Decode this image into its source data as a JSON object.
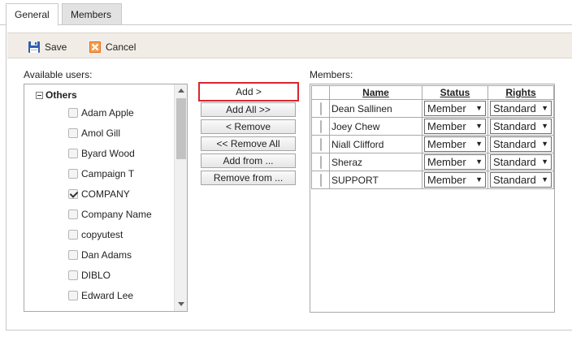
{
  "tabs": [
    {
      "label": "General",
      "active": true
    },
    {
      "label": "Members",
      "active": false
    }
  ],
  "toolbar": {
    "save_label": "Save",
    "cancel_label": "Cancel"
  },
  "available": {
    "label": "Available users:",
    "group": "Others",
    "users": [
      {
        "name": "Adam Apple",
        "checked": false
      },
      {
        "name": "Amol Gill",
        "checked": false
      },
      {
        "name": "Byard Wood",
        "checked": false
      },
      {
        "name": "Campaign T",
        "checked": false
      },
      {
        "name": "COMPANY",
        "checked": true
      },
      {
        "name": "Company Name",
        "checked": false
      },
      {
        "name": "copyutest",
        "checked": false
      },
      {
        "name": "Dan Adams",
        "checked": false
      },
      {
        "name": "DIBLO",
        "checked": false
      },
      {
        "name": "Edward Lee",
        "checked": false
      }
    ]
  },
  "actions": {
    "add": "Add >",
    "add_all": "Add All >>",
    "remove": "< Remove",
    "remove_all": "<< Remove All",
    "add_from": "Add from ...",
    "remove_from": "Remove from ..."
  },
  "members": {
    "label": "Members:",
    "columns": [
      "Name",
      "Status",
      "Rights"
    ],
    "rows": [
      {
        "name": "Dean Sallinen",
        "status": "Member",
        "rights": "Standard"
      },
      {
        "name": "Joey Chew",
        "status": "Member",
        "rights": "Standard"
      },
      {
        "name": "Niall Clifford",
        "status": "Member",
        "rights": "Standard"
      },
      {
        "name": "Sheraz",
        "status": "Member",
        "rights": "Standard"
      },
      {
        "name": "SUPPORT",
        "status": "Member",
        "rights": "Standard"
      }
    ]
  },
  "colors": {
    "highlight": "#d9262f",
    "toolbar_bg": "#f1ede6"
  },
  "icons": {
    "save": "floppy-disk-icon",
    "cancel": "cancel-x-icon",
    "collapse": "minus-box-icon"
  }
}
